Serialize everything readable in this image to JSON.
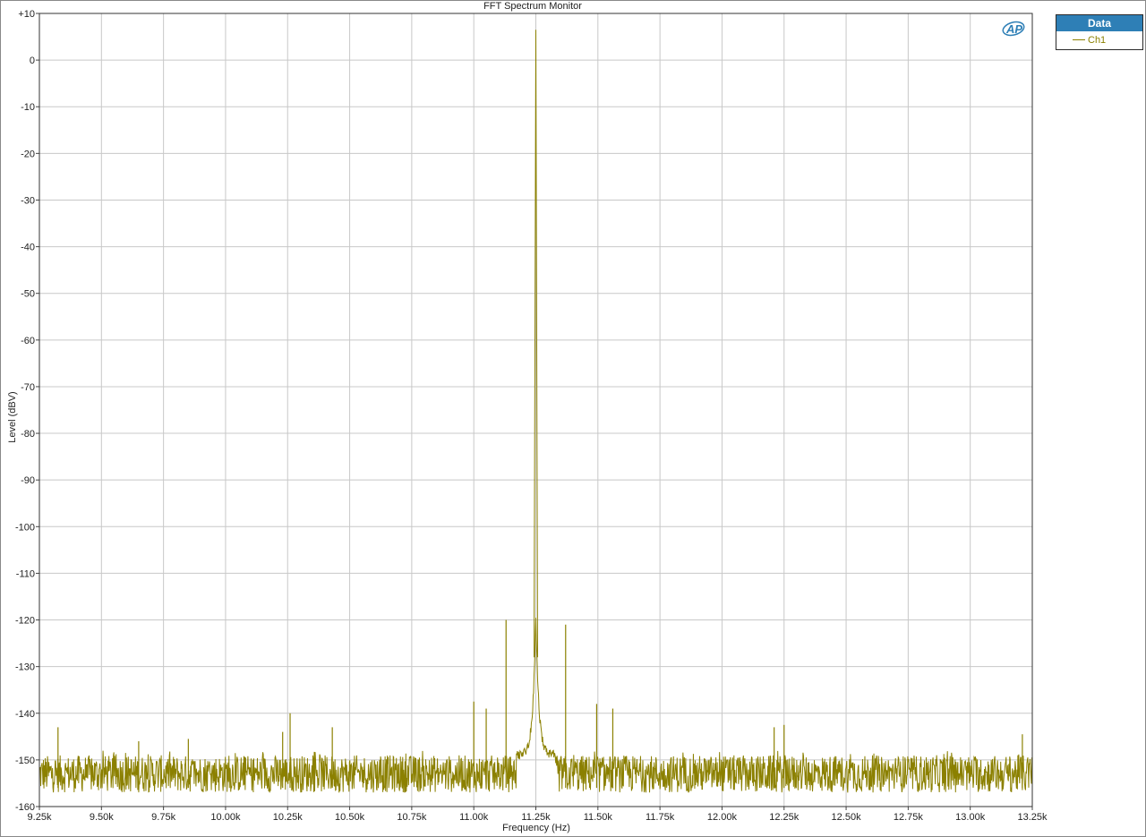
{
  "chart_data": {
    "type": "line",
    "title": "FFT Spectrum Monitor",
    "xlabel": "Frequency (Hz)",
    "ylabel": "Level (dBV)",
    "xlim": [
      9250,
      13250
    ],
    "ylim": [
      -160,
      10
    ],
    "grid": true,
    "legend_placement": "top-right outside",
    "xticks": [
      9250,
      9500,
      9750,
      10000,
      10250,
      10500,
      10750,
      11000,
      11250,
      11500,
      11750,
      12000,
      12250,
      12500,
      12750,
      13000,
      13250
    ],
    "xtick_labels": [
      "9.25k",
      "9.50k",
      "9.75k",
      "10.00k",
      "10.25k",
      "10.50k",
      "10.75k",
      "11.00k",
      "11.25k",
      "11.50k",
      "11.75k",
      "12.00k",
      "12.25k",
      "12.50k",
      "12.75k",
      "13.00k",
      "13.25k"
    ],
    "yticks": [
      10,
      0,
      -10,
      -20,
      -30,
      -40,
      -50,
      -60,
      -70,
      -80,
      -90,
      -100,
      -110,
      -120,
      -130,
      -140,
      -150,
      -160
    ],
    "ytick_labels": [
      "+10",
      "0",
      "-10",
      "-20",
      "-30",
      "-40",
      "-50",
      "-60",
      "-70",
      "-80",
      "-90",
      "-100",
      "-110",
      "-120",
      "-130",
      "-140",
      "-150",
      "-160"
    ],
    "noise_floor_range": [
      -159,
      -148
    ],
    "series": [
      {
        "name": "Ch1",
        "color": "#8b8000",
        "main_peak": {
          "x": 11250,
          "y": 6.5
        },
        "spurs": [
          {
            "x": 9325,
            "y": -143
          },
          {
            "x": 9650,
            "y": -146
          },
          {
            "x": 9850,
            "y": -145.5
          },
          {
            "x": 10230,
            "y": -144
          },
          {
            "x": 10260,
            "y": -140
          },
          {
            "x": 10430,
            "y": -143
          },
          {
            "x": 11000,
            "y": -137.5
          },
          {
            "x": 11050,
            "y": -139
          },
          {
            "x": 11130,
            "y": -120
          },
          {
            "x": 11370,
            "y": -121
          },
          {
            "x": 11495,
            "y": -138
          },
          {
            "x": 11560,
            "y": -139
          },
          {
            "x": 12210,
            "y": -143
          },
          {
            "x": 12250,
            "y": -142.5
          },
          {
            "x": 13210,
            "y": -144.5
          }
        ]
      }
    ]
  },
  "legend": {
    "header": "Data",
    "items": [
      "Ch1"
    ]
  },
  "logo": "AP"
}
